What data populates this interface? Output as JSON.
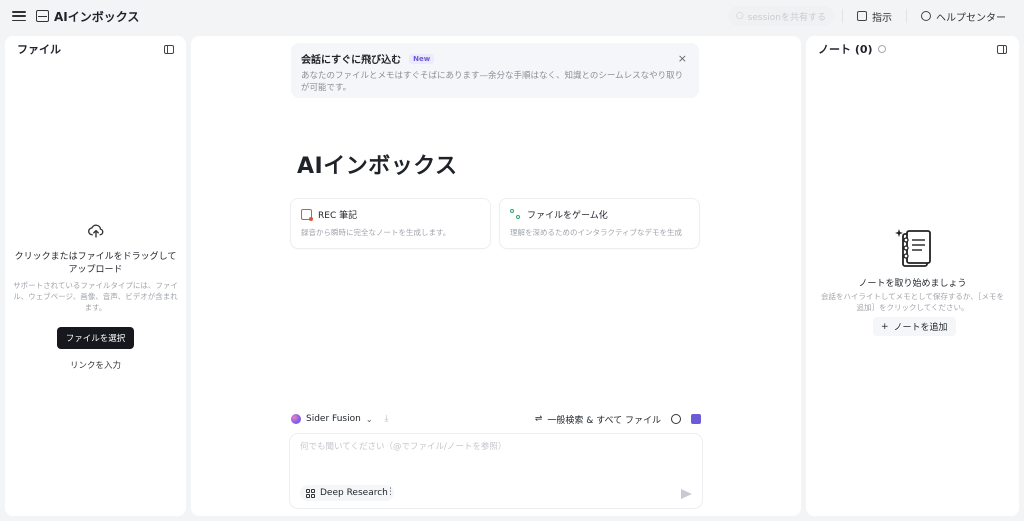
{
  "topbar": {
    "app_title": "AIインボックス",
    "share_label": "sessionを共有する",
    "instructions_label": "指示",
    "help_label": "ヘルプセンター"
  },
  "files_panel": {
    "title": "ファイル",
    "upload_title": "クリックまたはファイルをドラッグしてアップロード",
    "upload_desc": "サポートされているファイルタイプには、ファイル、ウェブページ、画像、音声、ビデオが含まれます。",
    "choose_button": "ファイルを選択",
    "link_label": "リンクを入力"
  },
  "center": {
    "banner": {
      "title": "会話にすぐに飛び込む",
      "badge": "New",
      "body": "あなたのファイルとメモはすぐそばにあります—余分な手順はなく、知識とのシームレスなやり取りが可能です。",
      "close": "×"
    },
    "heading": "AIインボックス",
    "cards": [
      {
        "title": "REC 筆記",
        "desc": "録音から瞬時に完全なノートを生成します。"
      },
      {
        "title": "ファイルをゲーム化",
        "desc": "理解を深めるためのインタラクティブなデモを生成"
      }
    ],
    "toolbar": {
      "model": "Sider Fusion",
      "search_scope": "一般検索 & すべて ファイル"
    },
    "input": {
      "placeholder": "何でも聞いてください（@でファイル/ノートを参照）"
    },
    "deep_research_label": "Deep Research",
    "more_label": "⋮"
  },
  "notes_panel": {
    "title": "ノート (0)",
    "empty_title": "ノートを取り始めましょう",
    "empty_desc": "会話をハイライトしてメモとして保存するか、［メモを追加］をクリックしてください。",
    "add_button": "ノートを追加"
  }
}
